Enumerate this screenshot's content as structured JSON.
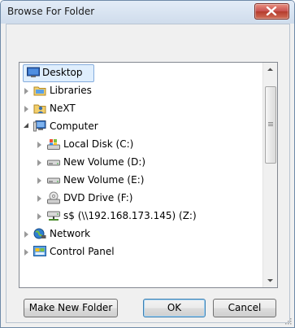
{
  "window": {
    "title": "Browse For Folder"
  },
  "tree": {
    "items": [
      {
        "label": "Desktop",
        "icon": "desktop-icon",
        "expander": "none",
        "selected": true
      },
      {
        "label": "Libraries",
        "icon": "libraries-folder-icon",
        "expander": "collapsed"
      },
      {
        "label": "NeXT",
        "icon": "user-folder-icon",
        "expander": "collapsed"
      },
      {
        "label": "Computer",
        "icon": "computer-icon",
        "expander": "expanded"
      },
      {
        "label": "Local Disk (C:)",
        "icon": "local-disk-icon",
        "expander": "collapsed"
      },
      {
        "label": "New Volume (D:)",
        "icon": "drive-icon",
        "expander": "collapsed"
      },
      {
        "label": "New Volume (E:)",
        "icon": "drive-icon",
        "expander": "collapsed"
      },
      {
        "label": "DVD Drive (F:)",
        "icon": "dvd-drive-icon",
        "expander": "collapsed"
      },
      {
        "label": "s$ (\\\\192.168.173.145) (Z:)",
        "icon": "network-drive-icon",
        "expander": "collapsed"
      },
      {
        "label": "Network",
        "icon": "network-icon",
        "expander": "collapsed"
      },
      {
        "label": "Control Panel",
        "icon": "control-panel-icon",
        "expander": "collapsed"
      }
    ]
  },
  "buttons": {
    "make_new_folder": "Make New Folder",
    "ok": "OK",
    "cancel": "Cancel"
  },
  "colors": {
    "selection": "#dfeefd",
    "selection_border": "#84acdd",
    "close_button": "#c75050"
  }
}
